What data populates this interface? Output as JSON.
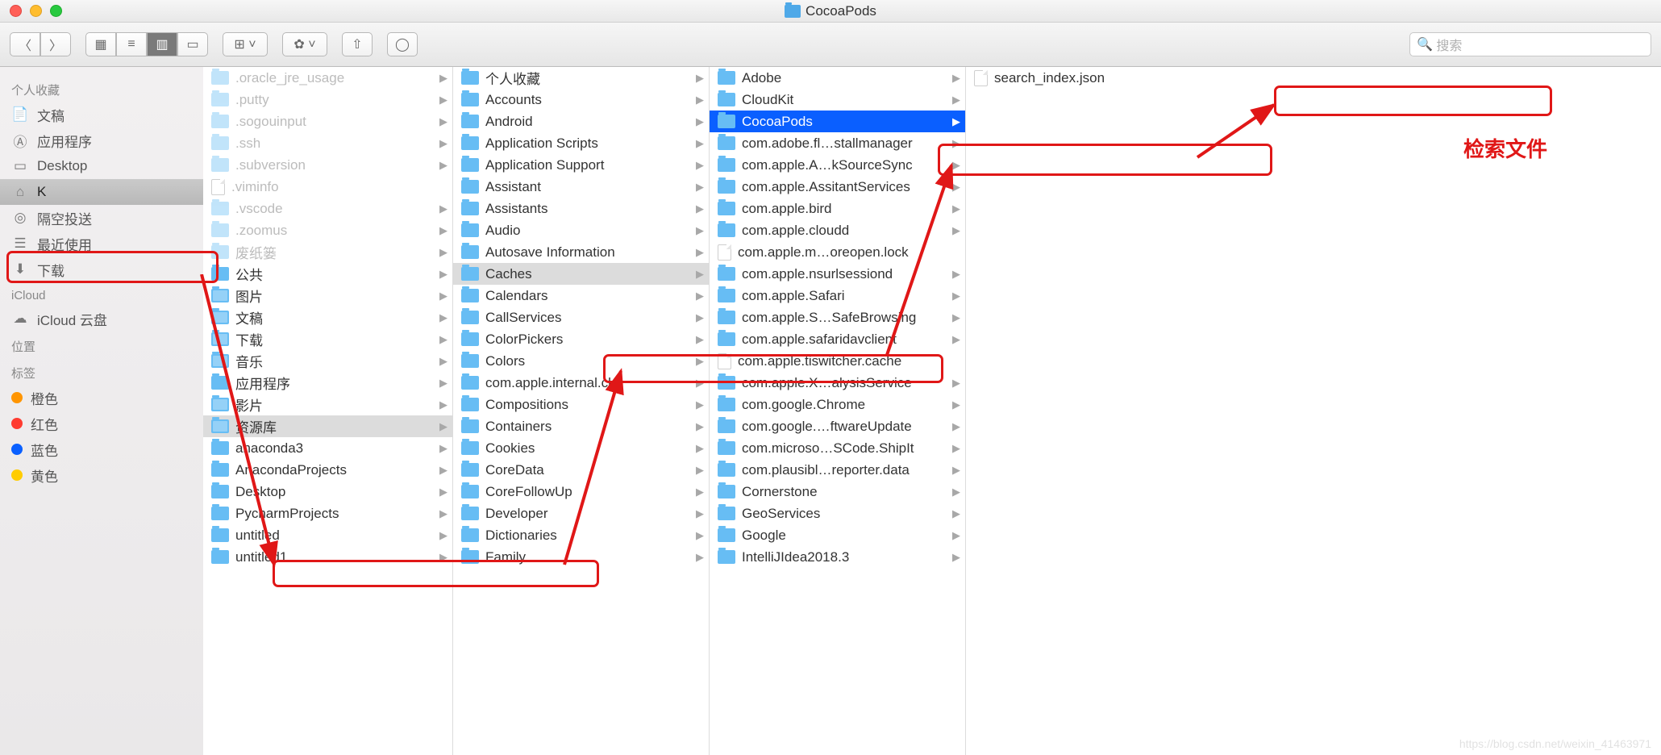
{
  "window": {
    "title": "CocoaPods"
  },
  "search": {
    "placeholder": "搜索"
  },
  "sidebar": {
    "s1": "个人收藏",
    "items1": [
      {
        "ico": "doc",
        "label": "文稿"
      },
      {
        "ico": "app",
        "label": "应用程序"
      },
      {
        "ico": "desk",
        "label": "Desktop"
      },
      {
        "ico": "home",
        "label": "K"
      },
      {
        "ico": "air",
        "label": "隔空投送"
      },
      {
        "ico": "recent",
        "label": "最近使用"
      },
      {
        "ico": "dl",
        "label": "下载"
      }
    ],
    "s2": "iCloud",
    "items2": [
      {
        "ico": "cloud",
        "label": "iCloud 云盘"
      }
    ],
    "s3": "位置",
    "s4": "标签",
    "tags": [
      {
        "c": "#ff9500",
        "label": "橙色"
      },
      {
        "c": "#ff3b30",
        "label": "红色"
      },
      {
        "c": "#0a60ff",
        "label": "蓝色"
      },
      {
        "c": "#ffcc00",
        "label": "黄色"
      }
    ]
  },
  "col1": [
    {
      "t": "f",
      "n": ".oracle_jre_usage",
      "d": true,
      "a": true
    },
    {
      "t": "f",
      "n": ".putty",
      "d": true,
      "a": true
    },
    {
      "t": "f",
      "n": ".sogouinput",
      "d": true,
      "a": true
    },
    {
      "t": "f",
      "n": ".ssh",
      "d": true,
      "a": true
    },
    {
      "t": "f",
      "n": ".subversion",
      "d": true,
      "a": true
    },
    {
      "t": "file",
      "n": ".viminfo",
      "d": true
    },
    {
      "t": "f",
      "n": ".vscode",
      "d": true,
      "a": true
    },
    {
      "t": "f",
      "n": ".zoomus",
      "d": true,
      "a": true
    },
    {
      "t": "f",
      "n": "废纸篓",
      "d": true,
      "a": true
    },
    {
      "t": "f",
      "n": "公共",
      "a": true
    },
    {
      "t": "f",
      "sub": "pic",
      "n": "图片",
      "a": true
    },
    {
      "t": "f",
      "sub": "doc",
      "n": "文稿",
      "a": true
    },
    {
      "t": "f",
      "sub": "dl",
      "n": "下载",
      "a": true
    },
    {
      "t": "f",
      "sub": "music",
      "n": "音乐",
      "a": true
    },
    {
      "t": "f",
      "n": "应用程序",
      "a": true
    },
    {
      "t": "f",
      "sub": "movie",
      "n": "影片",
      "a": true
    },
    {
      "t": "f",
      "sub": "lib",
      "n": "资源库",
      "a": true,
      "sg": true
    },
    {
      "t": "f",
      "n": "anaconda3",
      "a": true
    },
    {
      "t": "f",
      "n": "AnacondaProjects",
      "a": true
    },
    {
      "t": "f",
      "n": "Desktop",
      "a": true
    },
    {
      "t": "f",
      "n": "PycharmProjects",
      "a": true
    },
    {
      "t": "f",
      "n": "untitled",
      "a": true
    },
    {
      "t": "f",
      "n": "untitled1",
      "a": true
    }
  ],
  "col2": [
    {
      "t": "f",
      "n": "个人收藏",
      "a": true
    },
    {
      "t": "f",
      "n": "Accounts",
      "a": true
    },
    {
      "t": "f",
      "n": "Android",
      "a": true
    },
    {
      "t": "f",
      "n": "Application Scripts",
      "a": true
    },
    {
      "t": "f",
      "n": "Application Support",
      "a": true
    },
    {
      "t": "f",
      "n": "Assistant",
      "a": true
    },
    {
      "t": "f",
      "n": "Assistants",
      "a": true
    },
    {
      "t": "f",
      "n": "Audio",
      "a": true
    },
    {
      "t": "f",
      "n": "Autosave Information",
      "a": true
    },
    {
      "t": "f",
      "n": "Caches",
      "a": true,
      "sg": true
    },
    {
      "t": "f",
      "n": "Calendars",
      "a": true
    },
    {
      "t": "f",
      "n": "CallServices",
      "a": true
    },
    {
      "t": "f",
      "n": "ColorPickers",
      "a": true
    },
    {
      "t": "f",
      "n": "Colors",
      "a": true
    },
    {
      "t": "f",
      "n": "com.apple.internal.ck",
      "a": true
    },
    {
      "t": "f",
      "n": "Compositions",
      "a": true
    },
    {
      "t": "f",
      "n": "Containers",
      "a": true
    },
    {
      "t": "f",
      "n": "Cookies",
      "a": true
    },
    {
      "t": "f",
      "n": "CoreData",
      "a": true
    },
    {
      "t": "f",
      "n": "CoreFollowUp",
      "a": true
    },
    {
      "t": "f",
      "n": "Developer",
      "a": true
    },
    {
      "t": "f",
      "n": "Dictionaries",
      "a": true
    },
    {
      "t": "f",
      "n": "Family",
      "a": true
    }
  ],
  "col3": [
    {
      "t": "f",
      "n": "Adobe",
      "a": true
    },
    {
      "t": "f",
      "n": "CloudKit",
      "a": true
    },
    {
      "t": "f",
      "n": "CocoaPods",
      "a": true,
      "sb": true
    },
    {
      "t": "f",
      "n": "com.adobe.fl…stallmanager",
      "a": true
    },
    {
      "t": "f",
      "n": "com.apple.A…kSourceSync",
      "a": true
    },
    {
      "t": "f",
      "n": "com.apple.AssitantServices",
      "a": true
    },
    {
      "t": "f",
      "n": "com.apple.bird",
      "a": true
    },
    {
      "t": "f",
      "n": "com.apple.cloudd",
      "a": true
    },
    {
      "t": "file",
      "n": "com.apple.m…oreopen.lock"
    },
    {
      "t": "f",
      "n": "com.apple.nsurlsessiond",
      "a": true
    },
    {
      "t": "f",
      "n": "com.apple.Safari",
      "a": true
    },
    {
      "t": "f",
      "n": "com.apple.S…SafeBrowsing",
      "a": true
    },
    {
      "t": "f",
      "n": "com.apple.safaridavclient",
      "a": true
    },
    {
      "t": "file",
      "n": "com.apple.tiswitcher.cache"
    },
    {
      "t": "f",
      "n": "com.apple.X…alysisService",
      "a": true
    },
    {
      "t": "f",
      "n": "com.google.Chrome",
      "a": true
    },
    {
      "t": "f",
      "n": "com.google.…ftwareUpdate",
      "a": true
    },
    {
      "t": "f",
      "n": "com.microso…SCode.ShipIt",
      "a": true
    },
    {
      "t": "f",
      "n": "com.plausibl…reporter.data",
      "a": true
    },
    {
      "t": "f",
      "n": "Cornerstone",
      "a": true
    },
    {
      "t": "f",
      "n": "GeoServices",
      "a": true
    },
    {
      "t": "f",
      "n": "Google",
      "a": true
    },
    {
      "t": "f",
      "n": "IntelliJIdea2018.3",
      "a": true
    }
  ],
  "col4": [
    {
      "t": "file",
      "n": "search_index.json"
    }
  ],
  "annotation": {
    "label": "检索文件"
  }
}
